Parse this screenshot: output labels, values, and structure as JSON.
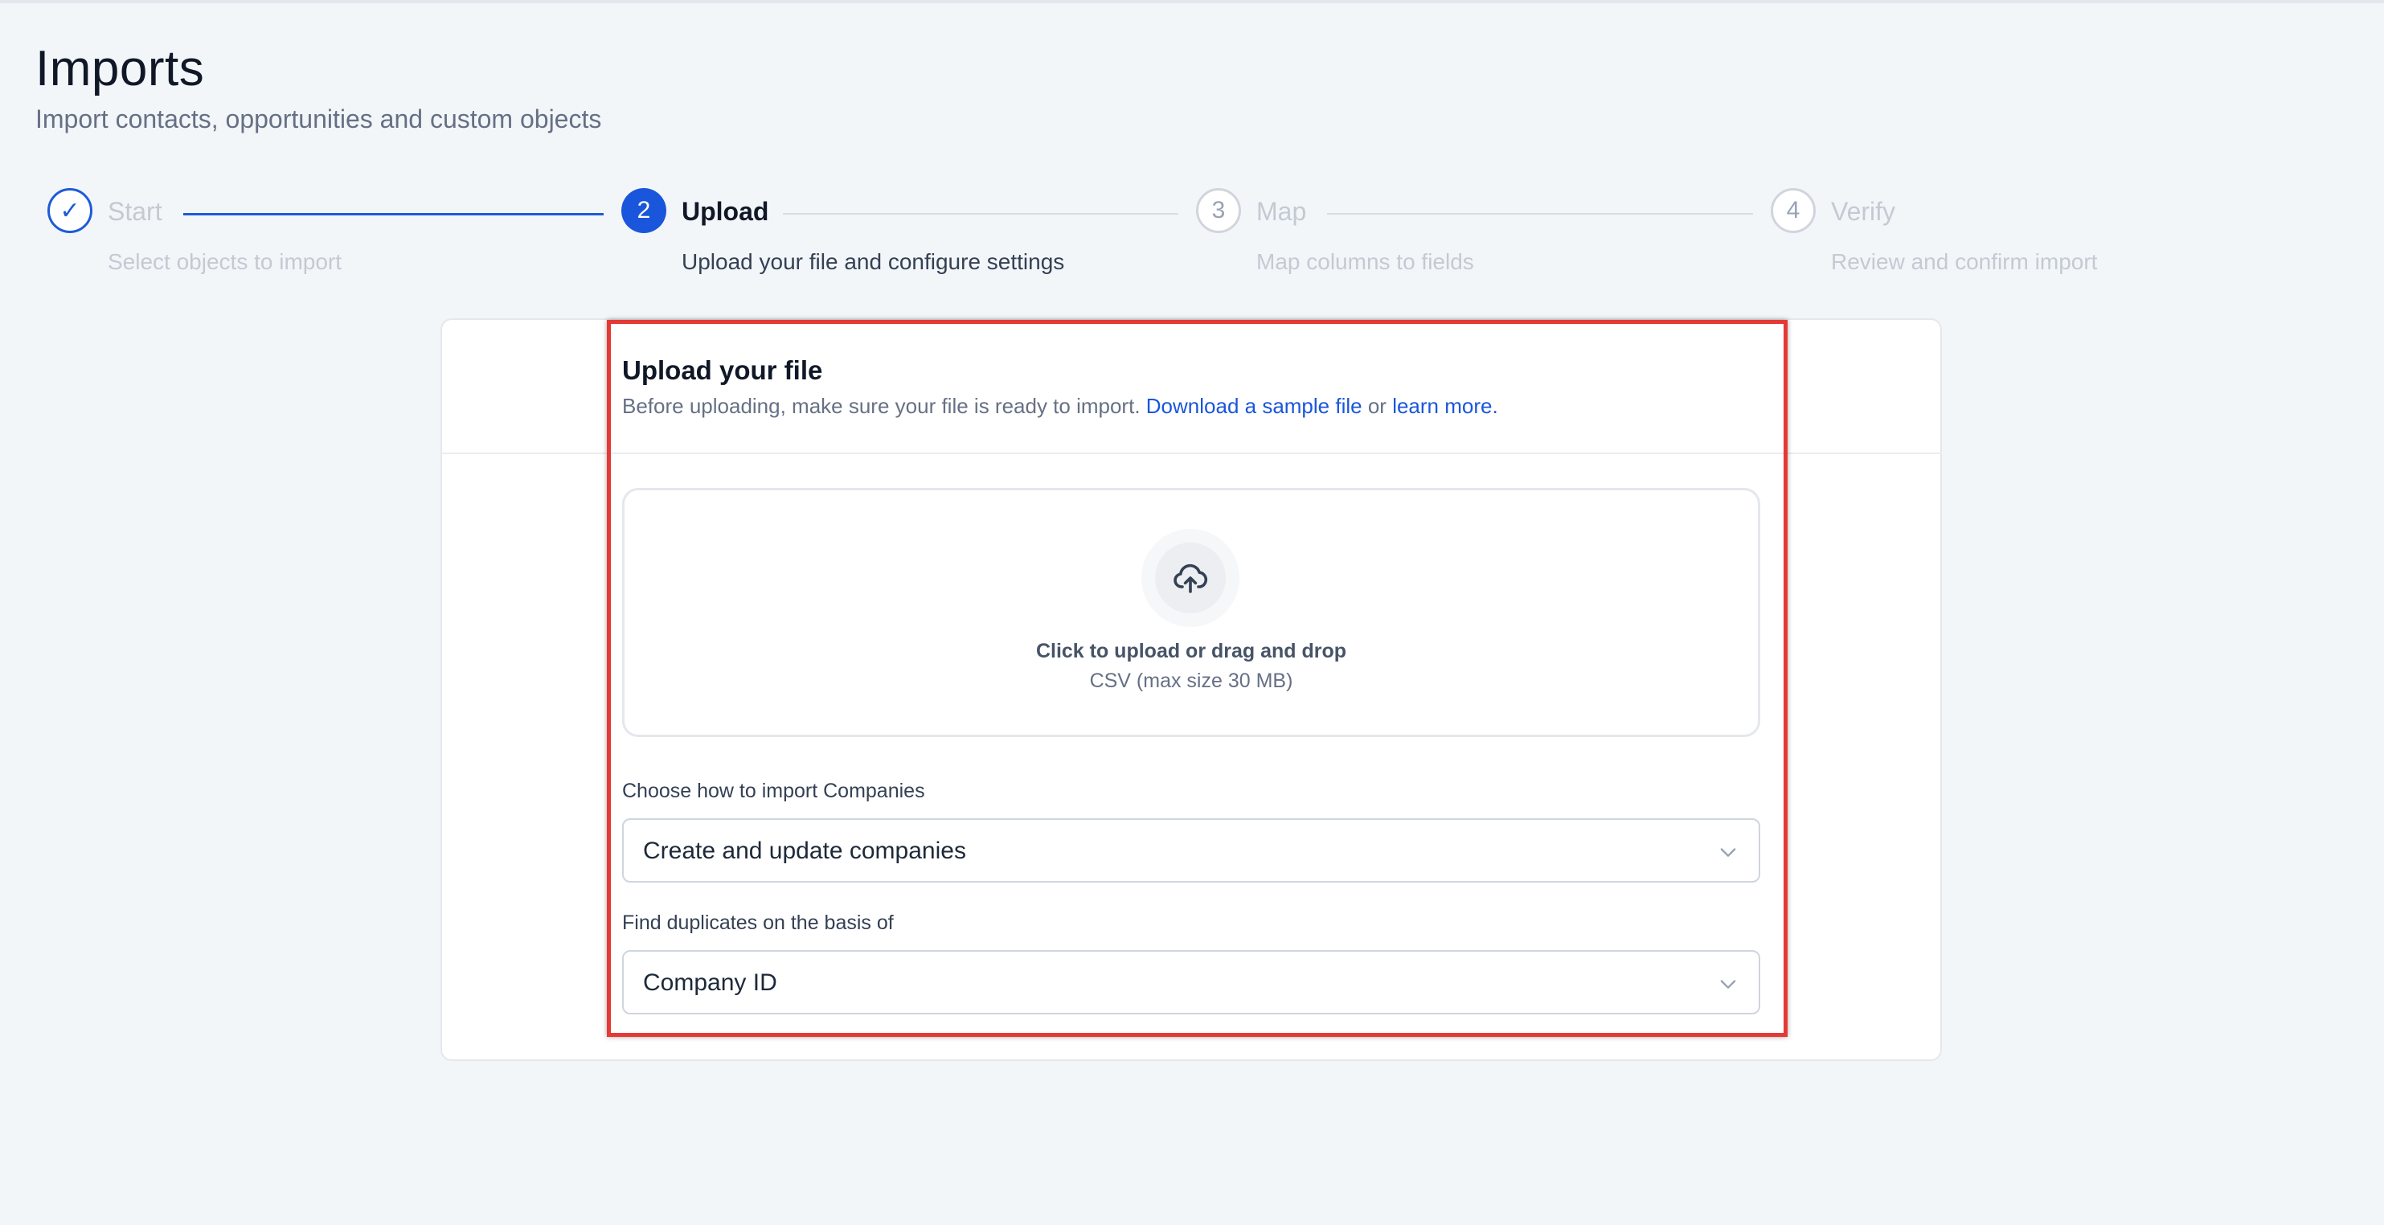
{
  "page": {
    "title": "Imports",
    "subtitle": "Import contacts, opportunities and custom objects"
  },
  "stepper": {
    "steps": [
      {
        "number": "✓",
        "title": "Start",
        "description": "Select objects to import",
        "state": "completed"
      },
      {
        "number": "2",
        "title": "Upload",
        "description": "Upload your file and configure settings",
        "state": "active"
      },
      {
        "number": "3",
        "title": "Map",
        "description": "Map columns to fields",
        "state": "pending"
      },
      {
        "number": "4",
        "title": "Verify",
        "description": "Review and confirm import",
        "state": "pending"
      }
    ]
  },
  "upload_card": {
    "title": "Upload your file",
    "description_prefix": "Before uploading, make sure your file is ready to import.",
    "sample_link": "Download a sample file",
    "connector": "or",
    "learn_link": "learn more",
    "description_suffix": ".",
    "dropzone": {
      "icon": "cloud-upload-icon",
      "primary_text": "Click to upload or drag and drop",
      "secondary_text": "CSV (max size 30 MB)"
    },
    "import_mode": {
      "label": "Choose how to import Companies",
      "value": "Create and update companies"
    },
    "duplicate_key": {
      "label": "Find duplicates on the basis of",
      "value": "Company ID"
    }
  },
  "colors": {
    "accent": "#1a56db",
    "highlight": "#e53935",
    "background": "#f3f6f9"
  }
}
